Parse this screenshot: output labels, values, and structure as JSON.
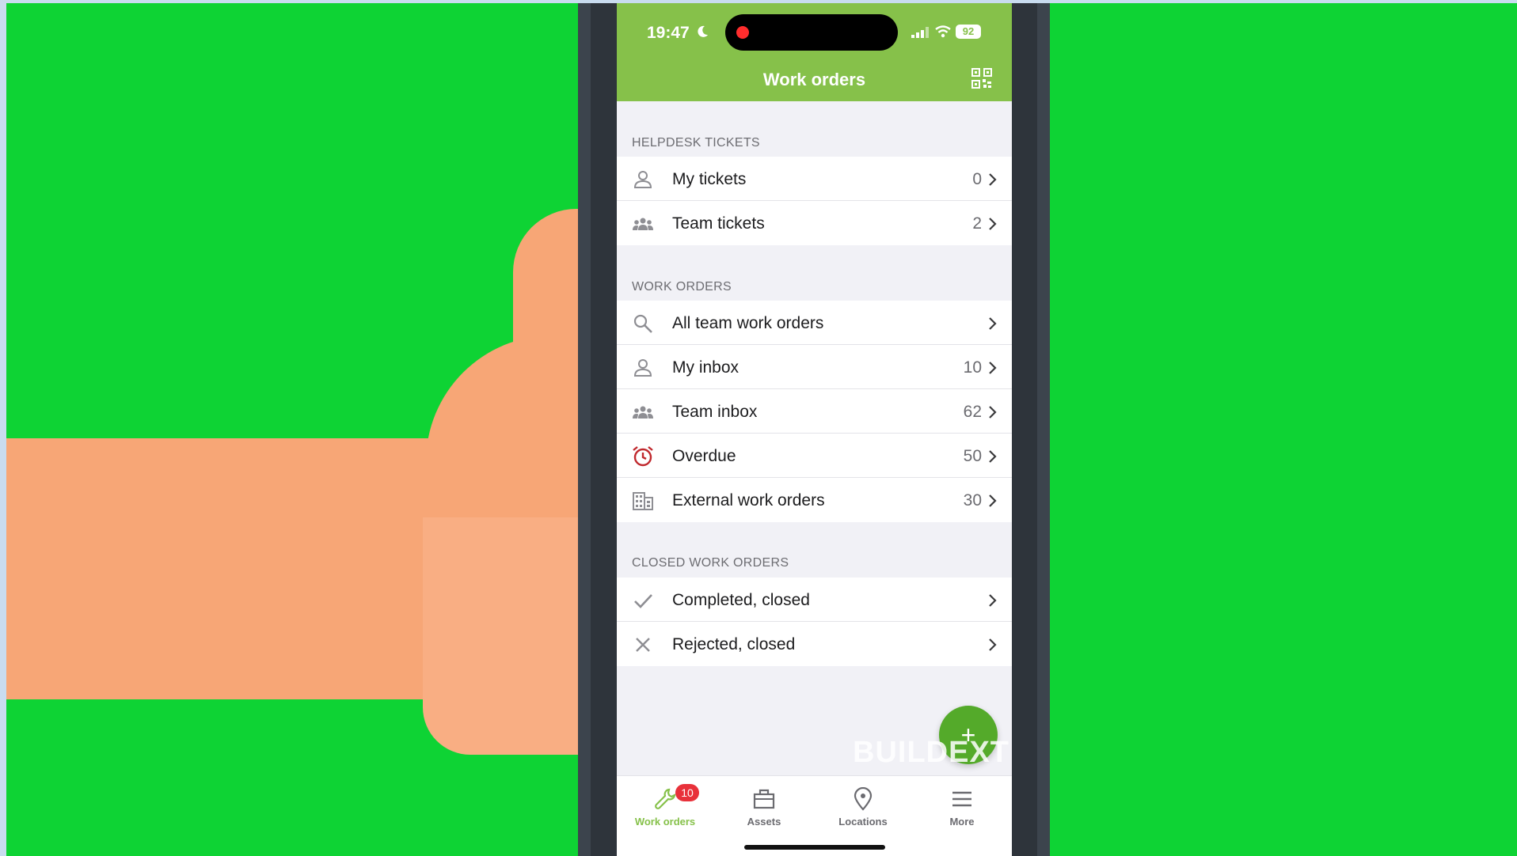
{
  "status_bar": {
    "time": "19:47",
    "battery": "92"
  },
  "header": {
    "title": "Work orders"
  },
  "sections": {
    "helpdesk": {
      "title": "HELPDESK TICKETS",
      "rows": [
        {
          "label": "My tickets",
          "count": "0"
        },
        {
          "label": "Team tickets",
          "count": "2"
        }
      ]
    },
    "work_orders": {
      "title": "WORK ORDERS",
      "rows": [
        {
          "label": "All team work orders",
          "count": ""
        },
        {
          "label": "My inbox",
          "count": "10"
        },
        {
          "label": "Team inbox",
          "count": "62"
        },
        {
          "label": "Overdue",
          "count": "50"
        },
        {
          "label": "External work orders",
          "count": "30"
        }
      ]
    },
    "closed": {
      "title": "CLOSED WORK ORDERS",
      "rows": [
        {
          "label": "Completed, closed",
          "count": ""
        },
        {
          "label": "Rejected, closed",
          "count": ""
        }
      ]
    }
  },
  "fab": {
    "symbol": "+"
  },
  "watermark": "BUILDEXT",
  "tabs": [
    {
      "label": "Work orders",
      "badge": "10",
      "icon": "wrench-icon"
    },
    {
      "label": "Assets",
      "icon": "toolbox-icon"
    },
    {
      "label": "Locations",
      "icon": "location-pin-icon"
    },
    {
      "label": "More",
      "icon": "menu-icon"
    }
  ],
  "colors": {
    "accent": "#86c14a",
    "background_green": "#0ed334",
    "badge": "#e8313a",
    "overdue_icon": "#c0282d",
    "fab": "#54aa2a"
  }
}
